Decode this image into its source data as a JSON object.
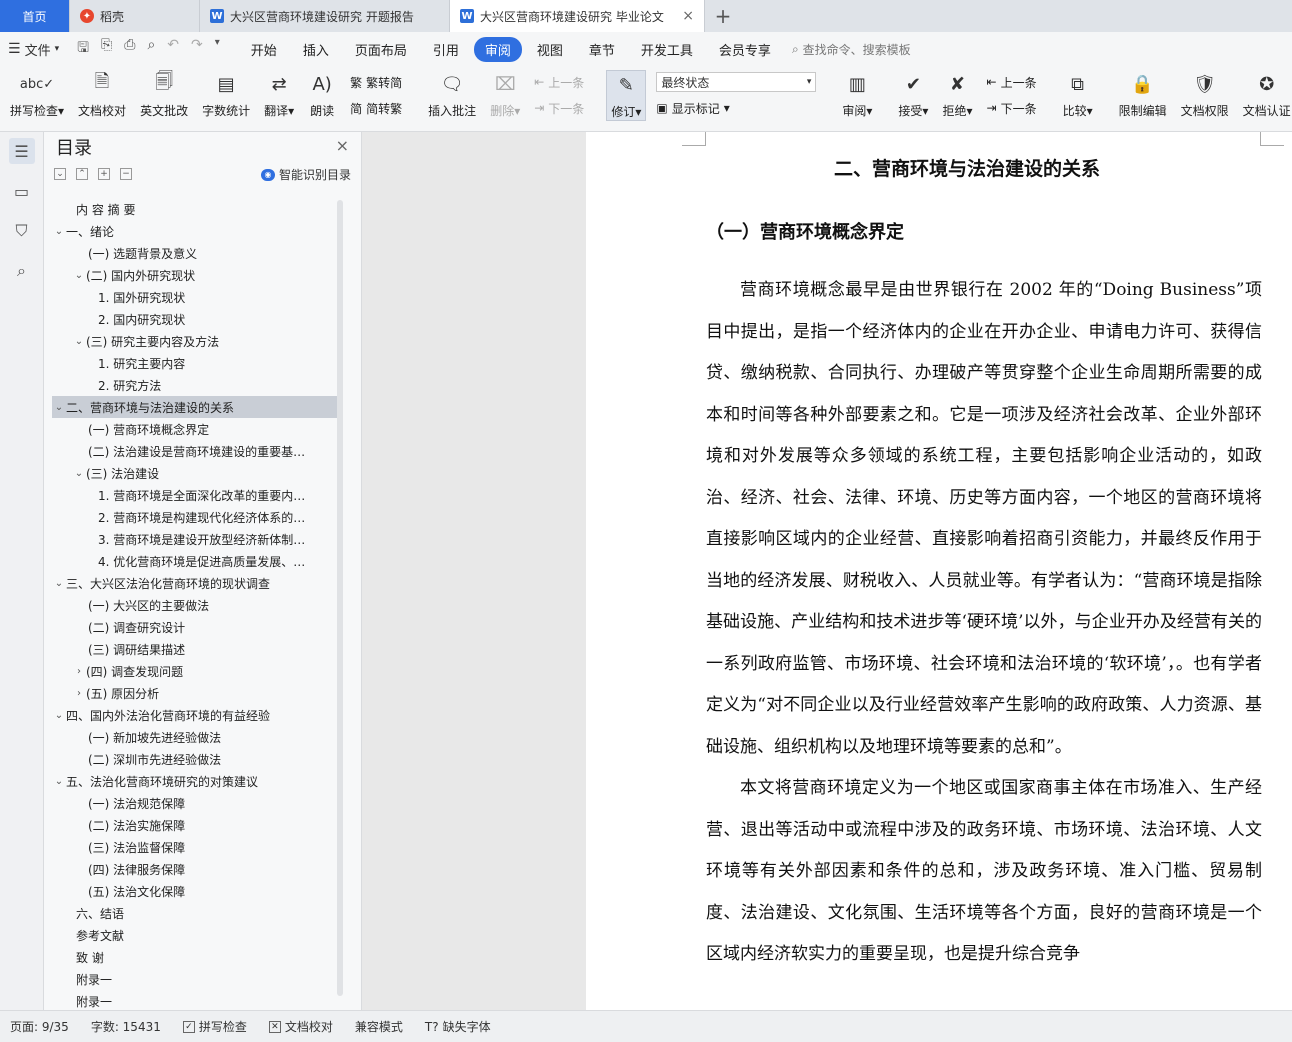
{
  "tabs": {
    "home": "首页",
    "daoke": "稻壳",
    "doc1": "大兴区营商环境建设研究 开题报告",
    "doc2": "大兴区营商环境建设研究 毕业论文",
    "close": "×",
    "add": "+"
  },
  "menubar": {
    "file": "文件",
    "items": [
      "开始",
      "插入",
      "页面布局",
      "引用",
      "审阅",
      "视图",
      "章节",
      "开发工具",
      "会员专享"
    ],
    "search": "查找命令、搜索模板"
  },
  "ribbon": {
    "spell": "拼写检查",
    "doc_check": "文档校对",
    "en_review": "英文批改",
    "word_count": "字数统计",
    "translate": "翻译",
    "read": "朗读",
    "trad": "繁转简",
    "simp": "简转繁",
    "insert_comment": "插入批注",
    "delete": "删除",
    "prev": "上一条",
    "next": "下一条",
    "revise": "修订",
    "final_state": "最终状态",
    "show_marks": "显示标记",
    "review": "审阅",
    "accept": "接受",
    "reject": "拒绝",
    "prev2": "上一条",
    "next2": "下一条",
    "compare": "比较",
    "restrict": "限制编辑",
    "perm": "文档权限",
    "cert": "文档认证"
  },
  "toc": {
    "title": "目录",
    "smart": "智能识别目录",
    "items": [
      {
        "t": "内 容 摘  要",
        "lvl": 1,
        "arr": ""
      },
      {
        "t": "一、绪论",
        "lvl": 0,
        "arr": "v"
      },
      {
        "t": "(一) 选题背景及意义",
        "lvl": 2,
        "arr": ""
      },
      {
        "t": "(二) 国内外研究现状",
        "lvl": 1,
        "arr": "v"
      },
      {
        "t": "1. 国外研究现状",
        "lvl": 3,
        "arr": ""
      },
      {
        "t": "2. 国内研究现状",
        "lvl": 3,
        "arr": ""
      },
      {
        "t": "(三) 研究主要内容及方法",
        "lvl": 1,
        "arr": "v"
      },
      {
        "t": "1. 研究主要内容",
        "lvl": 3,
        "arr": ""
      },
      {
        "t": "2. 研究方法",
        "lvl": 3,
        "arr": ""
      },
      {
        "t": "二、营商环境与法治建设的关系",
        "lvl": 0,
        "arr": "v",
        "sel": true
      },
      {
        "t": "(一) 营商环境概念界定",
        "lvl": 2,
        "arr": ""
      },
      {
        "t": "(二) 法治建设是营商环境建设的重要基…",
        "lvl": 2,
        "arr": ""
      },
      {
        "t": "(三) 法治建设",
        "lvl": 1,
        "arr": "v"
      },
      {
        "t": "1. 营商环境是全面深化改革的重要内…",
        "lvl": 3,
        "arr": ""
      },
      {
        "t": "2. 营商环境是构建现代化经济体系的…",
        "lvl": 3,
        "arr": ""
      },
      {
        "t": "3. 营商环境是建设开放型经济新体制…",
        "lvl": 3,
        "arr": ""
      },
      {
        "t": "4. 优化营商环境是促进高质量发展、…",
        "lvl": 3,
        "arr": ""
      },
      {
        "t": "三、大兴区法治化营商环境的现状调查",
        "lvl": 0,
        "arr": "v"
      },
      {
        "t": "(一) 大兴区的主要做法",
        "lvl": 2,
        "arr": ""
      },
      {
        "t": "(二) 调查研究设计",
        "lvl": 2,
        "arr": ""
      },
      {
        "t": "(三) 调研结果描述",
        "lvl": 2,
        "arr": ""
      },
      {
        "t": "(四) 调查发现问题",
        "lvl": 1,
        "arr": ">"
      },
      {
        "t": "(五) 原因分析",
        "lvl": 1,
        "arr": ">"
      },
      {
        "t": "四、国内外法治化营商环境的有益经验",
        "lvl": 0,
        "arr": "v"
      },
      {
        "t": "(一) 新加坡先进经验做法",
        "lvl": 2,
        "arr": ""
      },
      {
        "t": "(二) 深圳市先进经验做法",
        "lvl": 2,
        "arr": ""
      },
      {
        "t": "五、法治化营商环境研究的对策建议",
        "lvl": 0,
        "arr": "v"
      },
      {
        "t": "(一) 法治规范保障",
        "lvl": 2,
        "arr": ""
      },
      {
        "t": "(二) 法治实施保障",
        "lvl": 2,
        "arr": ""
      },
      {
        "t": "(三) 法治监督保障",
        "lvl": 2,
        "arr": ""
      },
      {
        "t": "(四) 法律服务保障",
        "lvl": 2,
        "arr": ""
      },
      {
        "t": "(五) 法治文化保障",
        "lvl": 2,
        "arr": ""
      },
      {
        "t": "六、结语",
        "lvl": 1,
        "arr": ""
      },
      {
        "t": "参考文献",
        "lvl": 1,
        "arr": ""
      },
      {
        "t": "致  谢",
        "lvl": 1,
        "arr": ""
      },
      {
        "t": "附录一",
        "lvl": 1,
        "arr": ""
      },
      {
        "t": "附录一",
        "lvl": 1,
        "arr": ""
      }
    ]
  },
  "doc": {
    "h2": "二、营商环境与法治建设的关系",
    "h3": "（一）营商环境概念界定",
    "p1": "营商环境概念最早是由世界银行在 2002 年的“Doing Business”项目中提出，是指一个经济体内的企业在开办企业、申请电力许可、获得信贷、缴纳税款、合同执行、办理破产等贯穿整个企业生命周期所需要的成本和时间等各种外部要素之和。它是一项涉及经济社会改革、企业外部环境和对外发展等众多领域的系统工程，主要包括影响企业活动的，如政治、经济、社会、法律、环境、历史等方面内容，一个地区的营商环境将直接影响区域内的企业经营、直接影响着招商引资能力，并最终反作用于当地的经济发展、财税收入、人员就业等。有学者认为：“营商环境是指除基础设施、产业结构和技术进步等‘硬环境’以外，与企业开办及经营有关的一系列政府监管、市场环境、社会环境和法治环境的‘软环境’，。也有学者定义为“对不同企业以及行业经营效率产生影响的政府政策、人力资源、基础设施、组织机构以及地理环境等要素的总和”。",
    "p2": "本文将营商环境定义为一个地区或国家商事主体在市场准入、生产经营、退出等活动中或流程中涉及的政务环境、市场环境、法治环境、人文环境等有关外部因素和条件的总和，涉及政务环境、准入门槛、贸易制度、法治建设、文化氛围、生活环境等各个方面，良好的营商环境是一个区域内经济软实力的重要呈现，也是提升综合竞争"
  },
  "status": {
    "page": "页面: 9/35",
    "words": "字数: 15431",
    "spell": "拼写检查",
    "check": "文档校对",
    "compat": "兼容模式",
    "font": "缺失字体"
  }
}
